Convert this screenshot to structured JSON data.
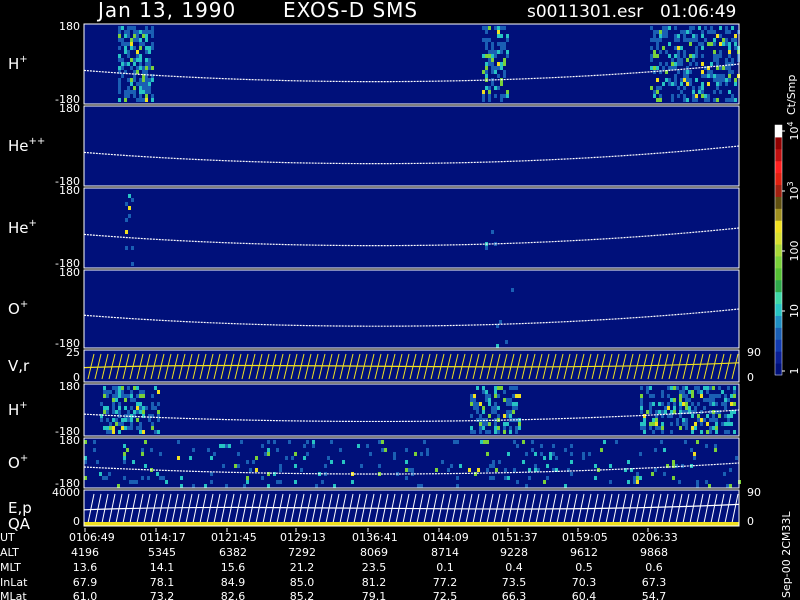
{
  "header": {
    "date": "Jan 13, 1990",
    "instrument": "EXOS-D SMS",
    "file": "s0011301.esr",
    "time": "01:06:49"
  },
  "colors": {
    "background": "#000000",
    "panel_bg": "#00107a",
    "panel_border": "#ffffff",
    "trace": "#ffffff",
    "flux_low": "#1a5fb4",
    "flux_mid": "#27c4c4",
    "flux_high": "#7ad13a",
    "flux_peak": "#f0e020",
    "vr_fill": "#f0e020"
  },
  "panels": [
    {
      "id": "h-plus",
      "name": "H",
      "sup": "+",
      "ytop": "180",
      "ybottom": "-180"
    },
    {
      "id": "he-plus-plus",
      "name": "He",
      "sup": "++",
      "ytop": "180",
      "ybottom": "-180"
    },
    {
      "id": "he-plus",
      "name": "He",
      "sup": "+",
      "ytop": "180",
      "ybottom": "-180"
    },
    {
      "id": "o-plus",
      "name": "O",
      "sup": "+",
      "ytop": "180",
      "ybottom": "-180"
    },
    {
      "id": "vr",
      "name": "V,r",
      "sup": "",
      "ytop": "25",
      "ybottom": "0",
      "rtop": "90",
      "rbottom": "0"
    },
    {
      "id": "h-plus-2",
      "name": "H",
      "sup": "+",
      "ytop": "180",
      "ybottom": "-180"
    },
    {
      "id": "o-plus-2",
      "name": "O",
      "sup": "+",
      "ytop": "180",
      "ybottom": "-180"
    },
    {
      "id": "ep-qa",
      "name": "E,p",
      "sup": "",
      "name2": "QA",
      "ytop": "4000",
      "ybottom": "0",
      "rtop": "90",
      "rbottom": "0"
    }
  ],
  "colorbar": {
    "unit": "Ct/Smp",
    "ticks": [
      {
        "label": "1",
        "base": "",
        "exp": "",
        "level": 0
      },
      {
        "label": "10",
        "base": "",
        "exp": "",
        "level": 1
      },
      {
        "label": "100",
        "base": "",
        "exp": "",
        "level": 2
      },
      {
        "label": "",
        "base": "10",
        "exp": "3",
        "level": 3
      },
      {
        "label": "",
        "base": "10",
        "exp": "4",
        "level": 4
      }
    ]
  },
  "ephemeris": {
    "rows": [
      {
        "label": "UT",
        "values": [
          "0106:49",
          "0114:17",
          "0121:45",
          "0129:13",
          "0136:41",
          "0144:09",
          "0151:37",
          "0159:05",
          "0206:33"
        ]
      },
      {
        "label": "ALT",
        "values": [
          "4196",
          "5345",
          "6382",
          "7292",
          "8069",
          "8714",
          "9228",
          "9612",
          "9868"
        ]
      },
      {
        "label": "MLT",
        "values": [
          "13.6",
          "14.1",
          "15.6",
          "21.2",
          "23.5",
          "0.1",
          "0.4",
          "0.5",
          "0.6"
        ]
      },
      {
        "label": "InLat",
        "values": [
          "67.9",
          "78.1",
          "84.9",
          "85.0",
          "81.2",
          "77.2",
          "73.5",
          "70.3",
          "67.3"
        ]
      },
      {
        "label": "MLat",
        "values": [
          "61.0",
          "73.2",
          "82.6",
          "85.2",
          "79.1",
          "72.5",
          "66.3",
          "60.4",
          "54.7"
        ]
      }
    ]
  },
  "footer": {
    "stamp": "Sep-00 2CM33L"
  },
  "chart_data": {
    "type": "heatmap",
    "title": "Jan 13, 1990 EXOS-D SMS",
    "x": [
      "0106:49",
      "0114:17",
      "0121:45",
      "0129:13",
      "0136:41",
      "0144:09",
      "0151:37",
      "0159:05",
      "0206:33"
    ],
    "ylim": [
      -180,
      180
    ],
    "colorbar_unit": "Ct/Smp",
    "colorbar_ticks": [
      "1",
      "10",
      "100",
      "10^3",
      "10^4"
    ],
    "series": [
      {
        "name": "H+",
        "ylim": [
          -180,
          180
        ]
      },
      {
        "name": "He++",
        "ylim": [
          -180,
          180
        ]
      },
      {
        "name": "He+",
        "ylim": [
          -180,
          180
        ]
      },
      {
        "name": "O+",
        "ylim": [
          -180,
          180
        ]
      },
      {
        "name": "V,r",
        "ylim": [
          0,
          25
        ],
        "right_ylim": [
          0,
          90
        ]
      },
      {
        "name": "H+",
        "ylim": [
          -180,
          180
        ]
      },
      {
        "name": "O+",
        "ylim": [
          -180,
          180
        ]
      },
      {
        "name": "E,p",
        "ylim": [
          0,
          4000
        ],
        "right_ylim": [
          0,
          90
        ]
      }
    ]
  }
}
